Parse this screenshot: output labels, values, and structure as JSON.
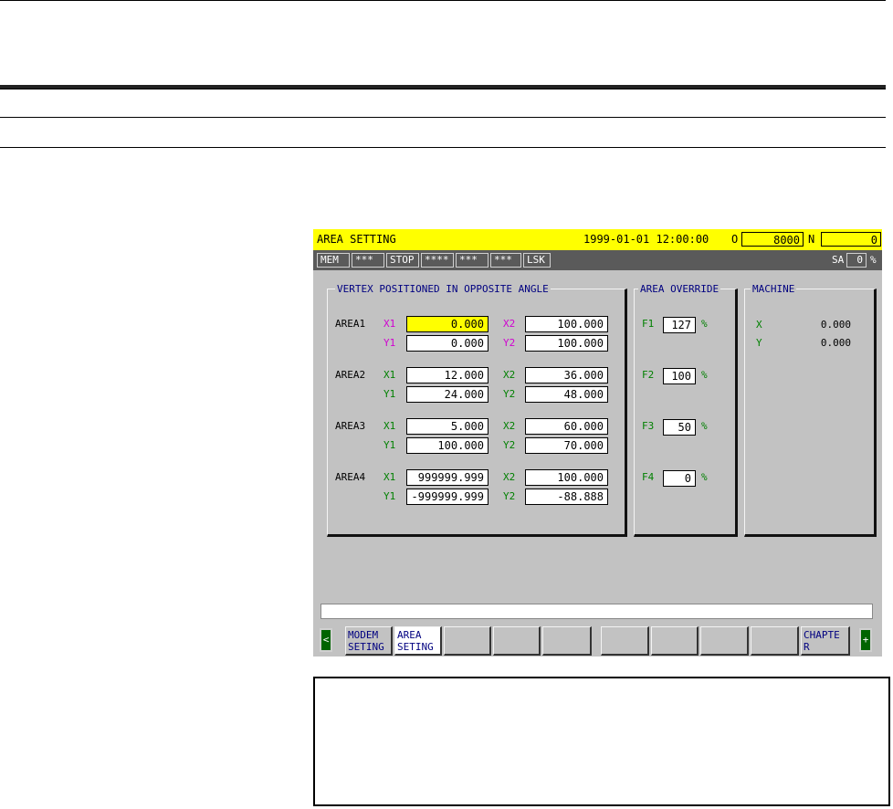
{
  "title_bar": {
    "title": "AREA SETTING",
    "datetime": "1999-01-01 12:00:00",
    "o_label": "O",
    "o_value": "8000",
    "n_label": "N",
    "n_value": "0"
  },
  "status_bar": {
    "items": [
      "MEM",
      "***",
      "STOP",
      "****",
      "***",
      "***",
      "LSK"
    ],
    "sa_label": "SA",
    "sa_value": "0",
    "sa_unit": "%"
  },
  "vertex_panel": {
    "title": "VERTEX POSITIONED IN OPPOSITE ANGLE",
    "areas": [
      {
        "name": "AREA1",
        "x1_label": "X1",
        "x1": "0.000",
        "y1_label": "Y1",
        "y1": "0.000",
        "x2_label": "X2",
        "x2": "100.000",
        "y2_label": "Y2",
        "y2": "100.000"
      },
      {
        "name": "AREA2",
        "x1_label": "X1",
        "x1": "12.000",
        "y1_label": "Y1",
        "y1": "24.000",
        "x2_label": "X2",
        "x2": "36.000",
        "y2_label": "Y2",
        "y2": "48.000"
      },
      {
        "name": "AREA3",
        "x1_label": "X1",
        "x1": "5.000",
        "y1_label": "Y1",
        "y1": "100.000",
        "x2_label": "X2",
        "x2": "60.000",
        "y2_label": "Y2",
        "y2": "70.000"
      },
      {
        "name": "AREA4",
        "x1_label": "X1",
        "x1": "999999.999",
        "y1_label": "Y1",
        "y1": "-999999.999",
        "x2_label": "X2",
        "x2": "100.000",
        "y2_label": "Y2",
        "y2": "-88.888"
      }
    ]
  },
  "override_panel": {
    "title": "AREA OVERRIDE",
    "items": [
      {
        "label": "F1",
        "value": "127",
        "unit": "%"
      },
      {
        "label": "F2",
        "value": "100",
        "unit": "%"
      },
      {
        "label": "F3",
        "value": "50",
        "unit": "%"
      },
      {
        "label": "F4",
        "value": "0",
        "unit": "%"
      }
    ]
  },
  "machine_panel": {
    "title": "MACHINE",
    "items": [
      {
        "label": "X",
        "value": "0.000"
      },
      {
        "label": "Y",
        "value": "0.000"
      }
    ]
  },
  "softkeys": {
    "left_arrow": "<",
    "right_arrow": "+",
    "keys": [
      "MODEM\nSETING",
      "AREA\nSETING",
      "",
      "",
      "",
      "",
      "",
      "",
      "",
      "CHAPTE\nR"
    ]
  },
  "colors": {
    "title_bar": "#ffff00",
    "status_bar": "#5a5a5a",
    "screen_bg": "#c2c2c2",
    "label_magenta": "#d000d0",
    "label_green": "#008000",
    "panel_title": "#000080"
  }
}
